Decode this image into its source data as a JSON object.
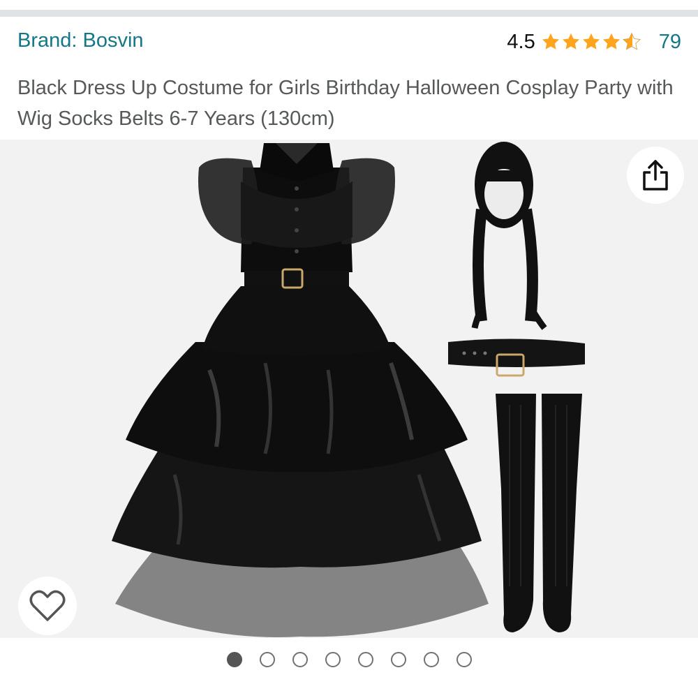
{
  "product": {
    "brand": "Brand: Bosvin",
    "rating": "4.5",
    "star_fill": [
      1,
      1,
      1,
      1,
      0.5
    ],
    "review_count": "79",
    "title": "Black Dress Up Costume for Girls Birthday Halloween Cosplay Party with Wig Socks Belts 6-7 Years (130cm)"
  },
  "gallery": {
    "image_count": 8,
    "active_index": 0,
    "contents": [
      "black-dress",
      "black-braided-wig",
      "black-belt",
      "black-knee-socks"
    ]
  },
  "icons": {
    "share": "share-icon",
    "wishlist": "heart-icon",
    "star": "star-icon"
  },
  "colors": {
    "link": "#147787",
    "star": "#ffa41c",
    "title_text": "#565959",
    "active_dot": "#555555"
  }
}
